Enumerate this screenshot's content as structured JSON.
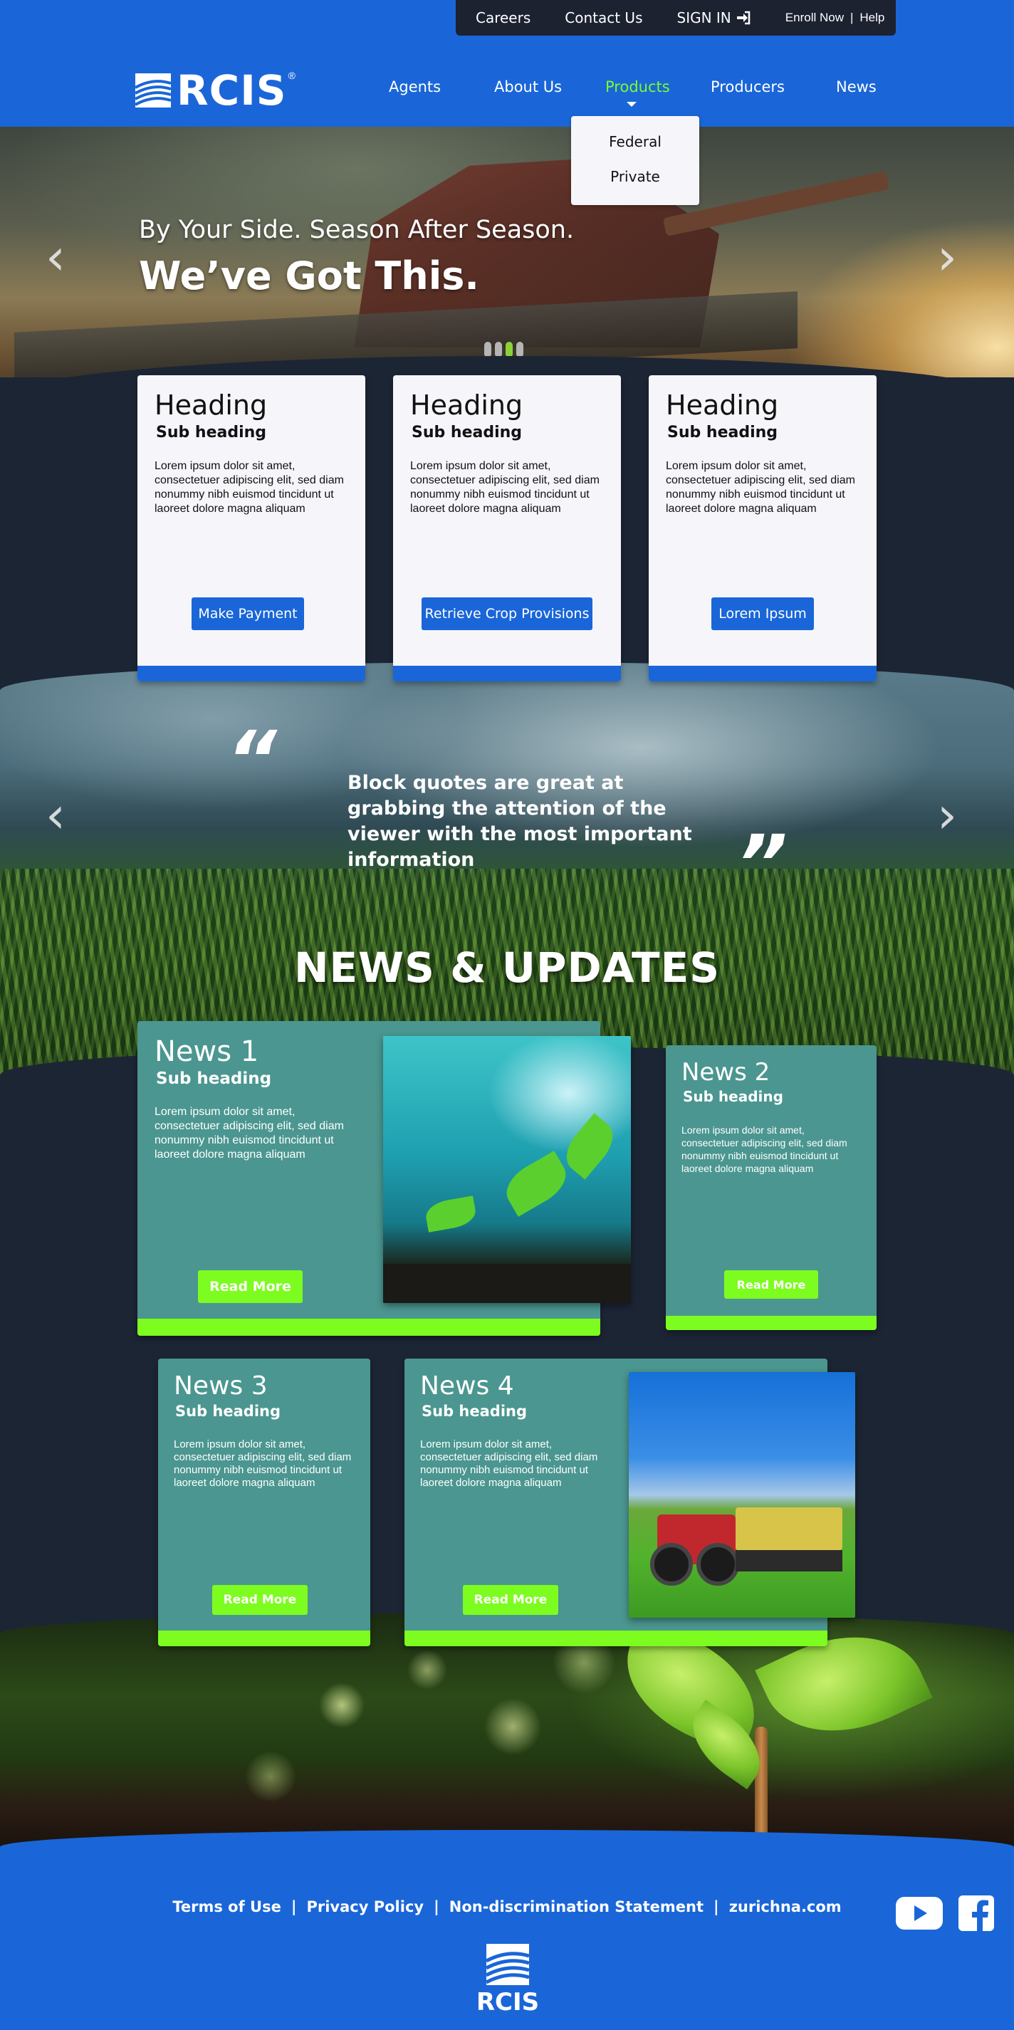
{
  "utility_nav": {
    "careers": "Careers",
    "contact": "Contact Us",
    "sign_in": "SIGN IN",
    "enroll": "Enroll Now",
    "separator": "|",
    "help": "Help"
  },
  "brand": {
    "name": "RCIS",
    "registered": "®"
  },
  "main_nav": {
    "items": [
      "Agents",
      "About Us",
      "Products",
      "Producers",
      "News"
    ],
    "active": "Products"
  },
  "products_dropdown": [
    "Federal",
    "Private"
  ],
  "hero": {
    "subtitle": "By Your Side. Season After Season.",
    "title": "We’ve Got This.",
    "slide_count": 4,
    "active_slide": 3
  },
  "cards": [
    {
      "heading": "Heading",
      "subheading": "Sub heading",
      "body": "Lorem ipsum dolor sit amet, consectetuer adipiscing elit, sed diam nonummy nibh euismod tincidunt ut laoreet dolore magna aliquam",
      "button": "Make Payment"
    },
    {
      "heading": "Heading",
      "subheading": "Sub heading",
      "body": "Lorem ipsum dolor sit amet, consectetuer adipiscing elit, sed diam nonummy nibh euismod tincidunt ut laoreet dolore magna aliquam",
      "button": "Retrieve Crop Provisions"
    },
    {
      "heading": "Heading",
      "subheading": "Sub heading",
      "body": "Lorem ipsum dolor sit amet, consectetuer adipiscing elit, sed diam nonummy nibh euismod tincidunt ut laoreet dolore magna aliquam",
      "button": "Lorem Ipsum"
    }
  ],
  "quote": {
    "open_mark": "“",
    "close_mark": "”",
    "text": "Block quotes are great at grabbing the attention of the viewer with the most important information"
  },
  "news": {
    "title": "NEWS & UPDATES",
    "items": [
      {
        "heading": "News 1",
        "subheading": "Sub heading",
        "body": "Lorem ipsum dolor sit amet, consectetuer adipiscing elit, sed diam nonummy nibh euismod tincidunt ut laoreet dolore magna aliquam",
        "button": "Read More"
      },
      {
        "heading": "News 2",
        "subheading": "Sub heading",
        "body": "Lorem ipsum dolor sit amet, consectetuer adipiscing elit, sed diam nonummy nibh euismod tincidunt ut laoreet dolore magna aliquam",
        "button": "Read More"
      },
      {
        "heading": "News 3",
        "subheading": "Sub heading",
        "body": "Lorem ipsum dolor sit amet, consectetuer adipiscing elit, sed diam nonummy nibh euismod tincidunt ut laoreet dolore magna aliquam",
        "button": "Read More"
      },
      {
        "heading": "News 4",
        "subheading": "Sub heading",
        "body": "Lorem ipsum dolor sit amet, consectetuer adipiscing elit, sed diam nonummy nibh euismod tincidunt ut laoreet dolore magna aliquam",
        "button": "Read More"
      }
    ]
  },
  "footer": {
    "links": [
      "Terms of Use",
      "Privacy Policy",
      "Non-discrimination Statement",
      "zurichna.com"
    ],
    "separator": "|",
    "social": [
      "youtube-icon",
      "facebook-icon"
    ]
  },
  "colors": {
    "brand_blue": "#1a66d8",
    "accent_green": "#7dfc1f",
    "dark_navy": "#1c2534",
    "teal_card": "#4b9690",
    "active_nav": "#7cfc2e"
  },
  "icons": [
    "sign-in-icon",
    "rcis-logo-icon",
    "chevron-left-icon",
    "chevron-right-icon",
    "caret-down-icon",
    "youtube-icon",
    "facebook-icon"
  ]
}
